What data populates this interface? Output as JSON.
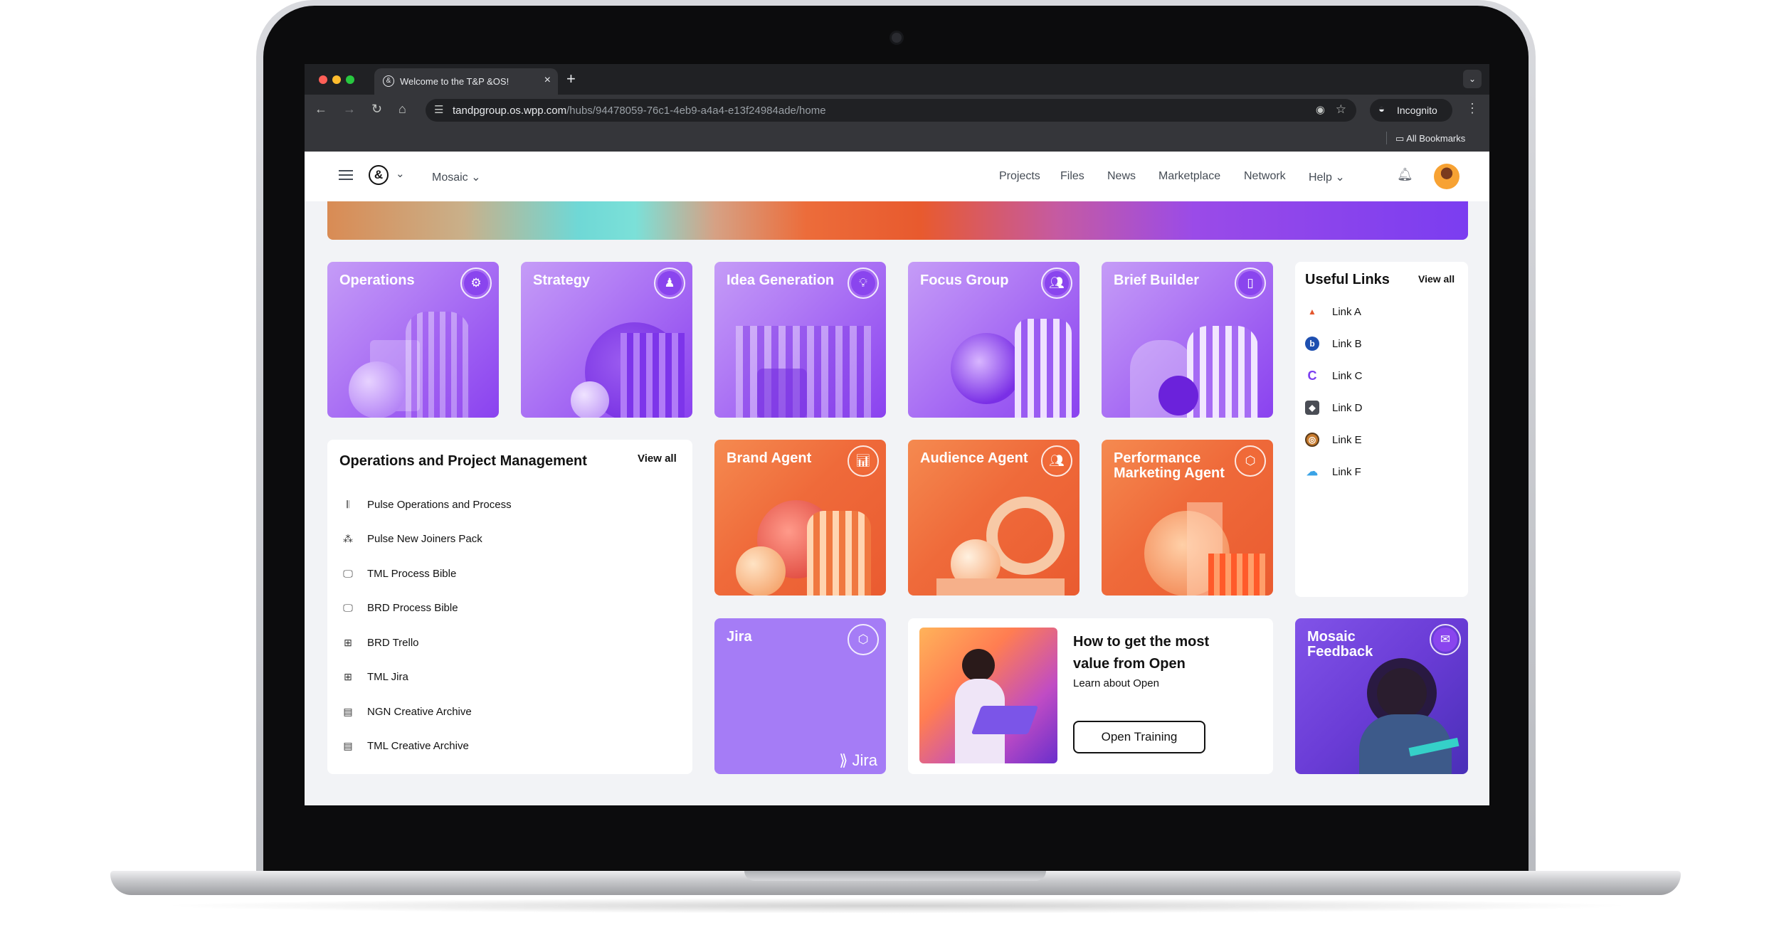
{
  "browser": {
    "tab_title": "Welcome to the T&P &OS!",
    "tab_close": "×",
    "new_tab": "+",
    "url_host": "tandpgroup.os.wpp.com",
    "url_path": "/hubs/94478059-76c1-4eb9-a4a4-e13f24984ade/home",
    "incognito_label": "Incognito",
    "bookmarks_label": "All Bookmarks"
  },
  "header": {
    "workspace": "Mosaic",
    "nav": [
      "Projects",
      "Files",
      "News",
      "Marketplace",
      "Network",
      "Help"
    ]
  },
  "tiles": {
    "operations": "Operations",
    "strategy": "Strategy",
    "idea_generation": "Idea Generation",
    "focus_group": "Focus Group",
    "brief_builder": "Brief Builder",
    "brand_agent": "Brand Agent",
    "audience_agent": "Audience Agent",
    "performance_line1": "Performance",
    "performance_line2": "Marketing Agent",
    "jira": "Jira",
    "jira_logo": "Jira",
    "mosaic_line1": "Mosaic",
    "mosaic_line2": "Feedback"
  },
  "useful_links": {
    "title": "Useful Links",
    "view_all": "View all",
    "items": [
      "Link A",
      "Link B",
      "Link C",
      "Link D",
      "Link E",
      "Link F"
    ]
  },
  "ops_panel": {
    "title": "Operations and Project Management",
    "view_all": "View all",
    "items": [
      "Pulse Operations and Process",
      "Pulse New Joiners Pack",
      "TML Process Bible",
      "BRD Process Bible",
      "BRD Trello",
      "TML Jira",
      "NGN Creative Archive",
      "TML Creative Archive"
    ]
  },
  "training": {
    "title_line1": "How to get the most",
    "title_line2": "value from Open",
    "subtitle": "Learn about Open",
    "button": "Open Training"
  },
  "colors": {
    "purple_accent": "#9c5cf2",
    "orange_accent": "#ef6a3a",
    "jira_bg": "#a57cf6",
    "mosaic_bg": "#6a3cd6",
    "page_bg": "#f2f3f6"
  }
}
